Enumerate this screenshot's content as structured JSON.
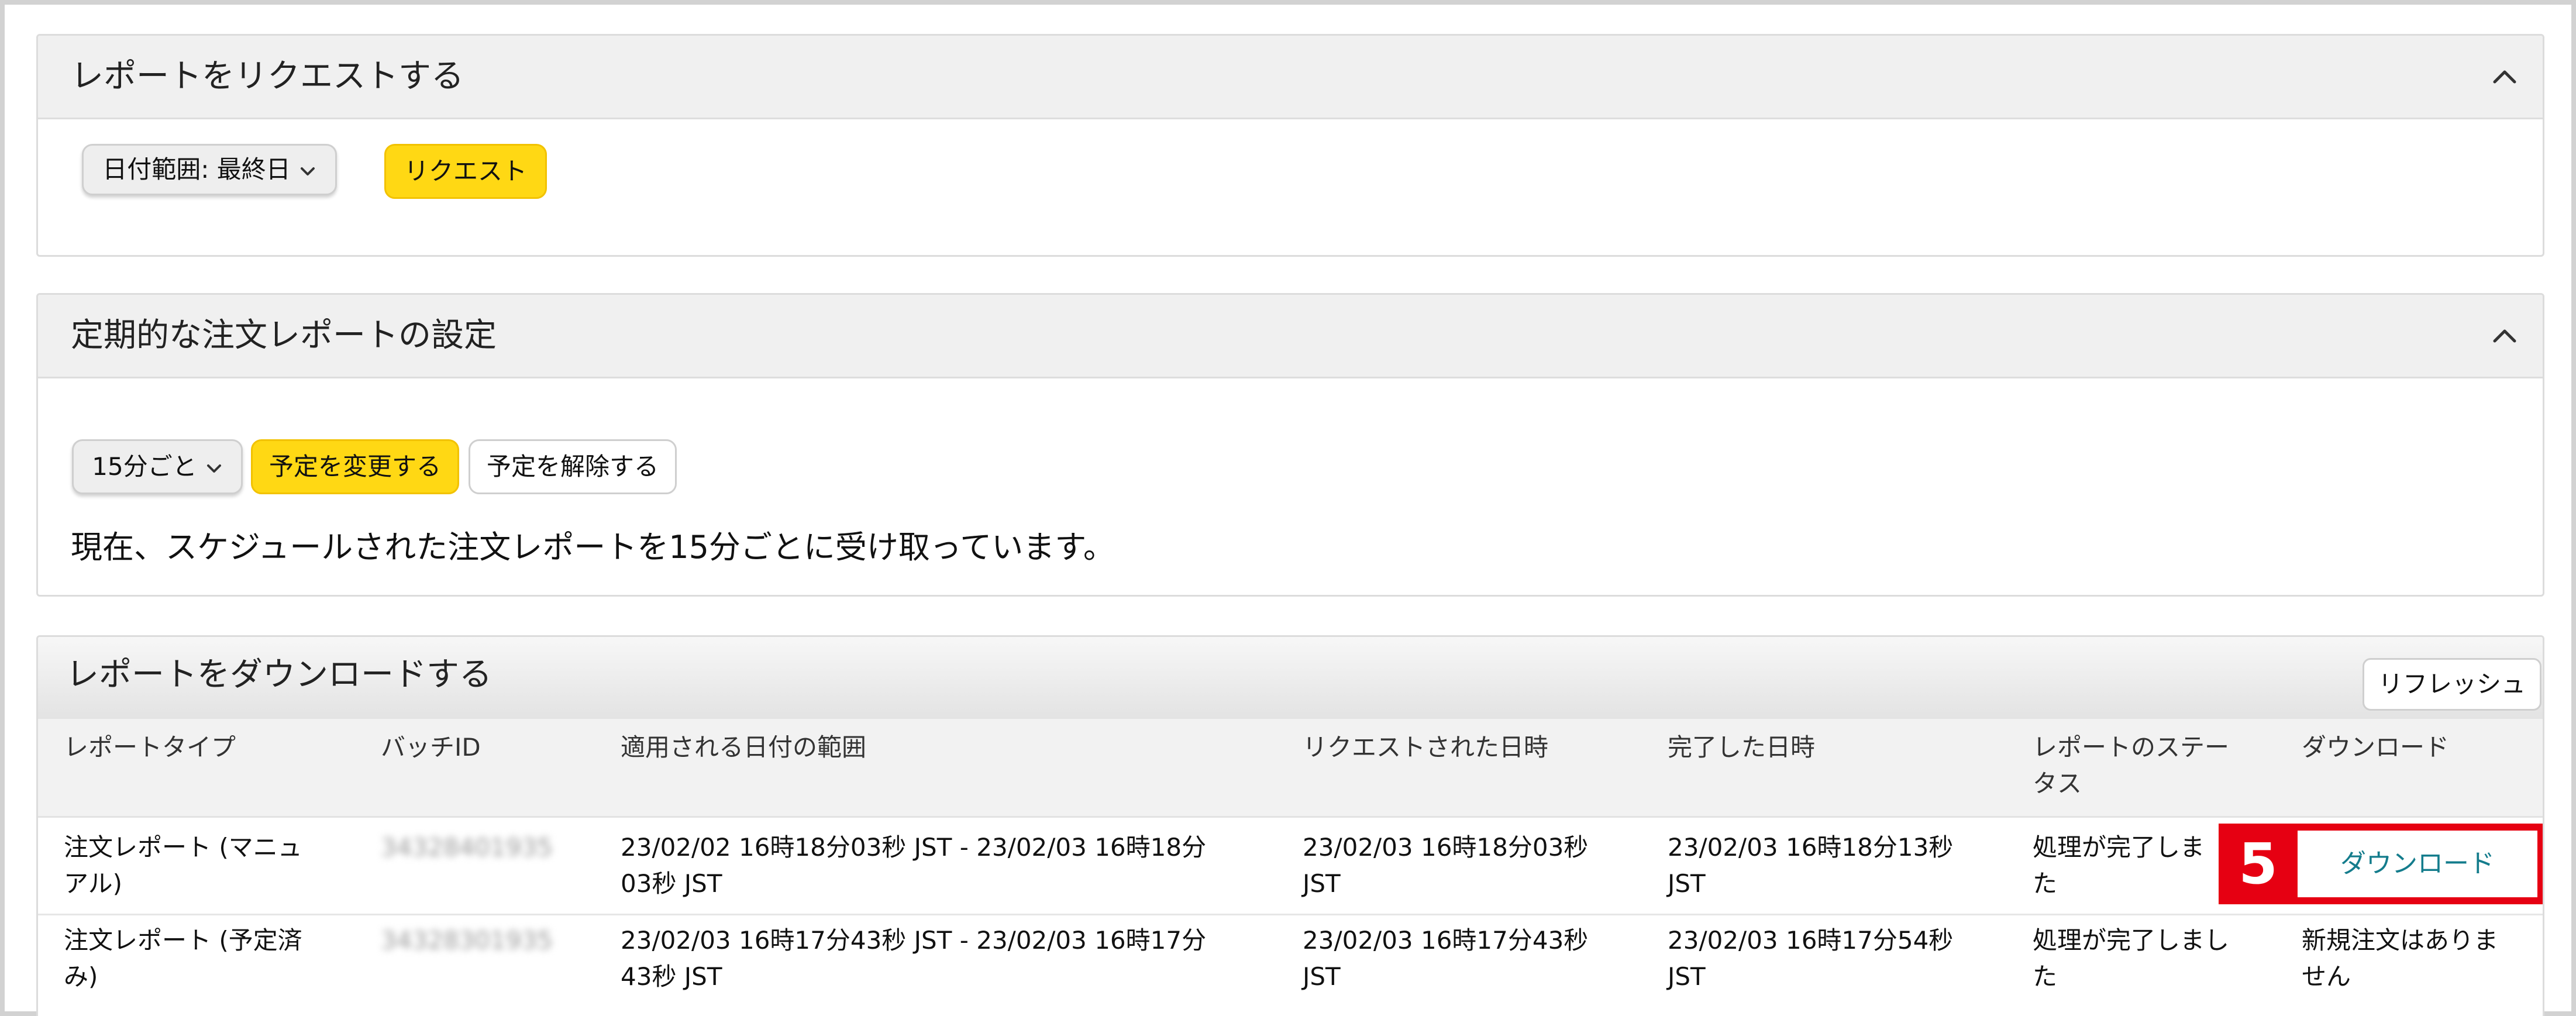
{
  "request_section": {
    "title": "レポートをリクエストする",
    "date_range_select": "日付範囲: 最終日",
    "request_button": "リクエスト"
  },
  "schedule_section": {
    "title": "定期的な注文レポートの設定",
    "interval_select": "15分ごと",
    "change_button": "予定を変更する",
    "cancel_button": "予定を解除する",
    "status_text": "現在、スケジュールされた注文レポートを15分ごとに受け取っています。"
  },
  "download_section": {
    "title": "レポートをダウンロードする",
    "refresh_button": "リフレッシュ",
    "columns": {
      "type": "レポートタイプ",
      "batch": "バッチID",
      "range": "適用される日付の範囲",
      "requested": "リクエストされた日時",
      "completed": "完了した日時",
      "status_l1": "レポートのステー",
      "status_l2": "タス",
      "download": "ダウンロード"
    },
    "rows": [
      {
        "type_l1": "注文レポート (マニュ",
        "type_l2": "アル)",
        "batch_id": "34328401935",
        "range_l1": "23/02/02 16時18分03秒 JST - 23/02/03 16時18分",
        "range_l2": "03秒 JST",
        "requested_l1": "23/02/03 16時18分03秒",
        "requested_l2": "JST",
        "completed_l1": "23/02/03 16時18分13秒",
        "completed_l2": "JST",
        "status_l1": "処理が完了しま",
        "status_l2": "た",
        "download": "ダウンロード"
      },
      {
        "type_l1": "注文レポート (予定済",
        "type_l2": "み)",
        "batch_id": "34328301935",
        "range_l1": "23/02/03 16時17分43秒 JST - 23/02/03 16時17分",
        "range_l2": "43秒 JST",
        "requested_l1": "23/02/03 16時17分43秒",
        "requested_l2": "JST",
        "completed_l1": "23/02/03 16時17分54秒",
        "completed_l2": "JST",
        "status_l1": "処理が完了しまし",
        "status_l2": "た",
        "download_l1": "新規注文はありま",
        "download_l2": "せん"
      }
    ]
  },
  "annotation": {
    "step_number": "5",
    "highlight_color": "#e60012"
  }
}
